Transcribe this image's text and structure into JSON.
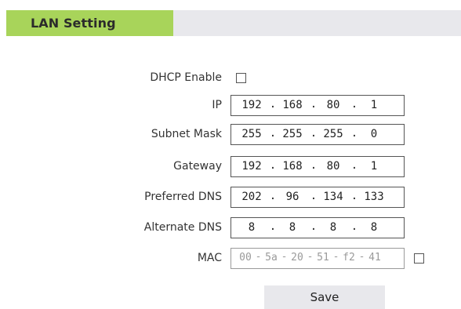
{
  "header": {
    "title": "LAN Setting"
  },
  "form": {
    "dhcp": {
      "label": "DHCP Enable",
      "checked": false
    },
    "ip": {
      "label": "IP",
      "octets": [
        "192",
        "168",
        "80",
        "1"
      ]
    },
    "subnet": {
      "label": "Subnet Mask",
      "octets": [
        "255",
        "255",
        "255",
        "0"
      ]
    },
    "gateway": {
      "label": "Gateway",
      "octets": [
        "192",
        "168",
        "80",
        "1"
      ]
    },
    "preferred_dns": {
      "label": "Preferred DNS",
      "octets": [
        "202",
        "96",
        "134",
        "133"
      ]
    },
    "alternate_dns": {
      "label": "Alternate DNS",
      "octets": [
        "8",
        "8",
        "8",
        "8"
      ]
    },
    "mac": {
      "label": "MAC",
      "parts": [
        "00",
        "5a",
        "20",
        "51",
        "f2",
        "41"
      ],
      "checked": false
    },
    "ip_separator": ".",
    "mac_separator": "-"
  },
  "save_label": "Save",
  "colors": {
    "header_tab": "#a8d45a",
    "header_bar": "#e8e8ec",
    "button_bg": "#e8e8ec"
  }
}
